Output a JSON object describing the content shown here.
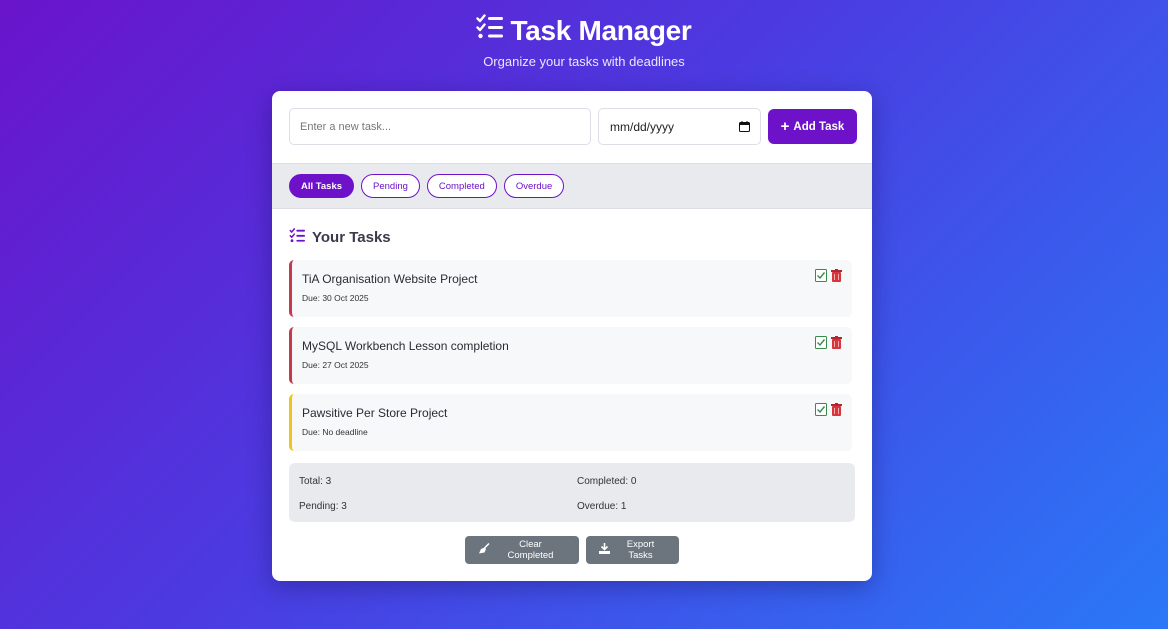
{
  "header": {
    "title": "Task Manager",
    "subtitle": "Organize your tasks with deadlines"
  },
  "add_form": {
    "task_placeholder": "Enter a new task...",
    "date_placeholder": "mm/dd/yyyy",
    "add_label": "Add Task"
  },
  "filters": [
    {
      "label": "All Tasks",
      "active": true
    },
    {
      "label": "Pending",
      "active": false
    },
    {
      "label": "Completed",
      "active": false
    },
    {
      "label": "Overdue",
      "active": false
    }
  ],
  "section_title": "Your Tasks",
  "tasks": [
    {
      "title": "TiA Organisation Website Project",
      "due": "Due: 30 Oct 2025",
      "status": "overdue"
    },
    {
      "title": "MySQL Workbench Lesson completion",
      "due": "Due: 27 Oct 2025",
      "status": "overdue"
    },
    {
      "title": "Pawsitive Per Store Project",
      "due": "Due: No deadline",
      "status": "no-deadline"
    }
  ],
  "stats": {
    "total": "Total: 3",
    "completed": "Completed: 0",
    "pending": "Pending: 3",
    "overdue": "Overdue: 1"
  },
  "actions": {
    "clear_label": "Clear Completed",
    "export_label": "Export Tasks"
  },
  "colors": {
    "accent": "#6d12c9",
    "overdue_border": "#c43a4a",
    "no_deadline_border": "#f0c419",
    "button_gray": "#6c757d"
  }
}
